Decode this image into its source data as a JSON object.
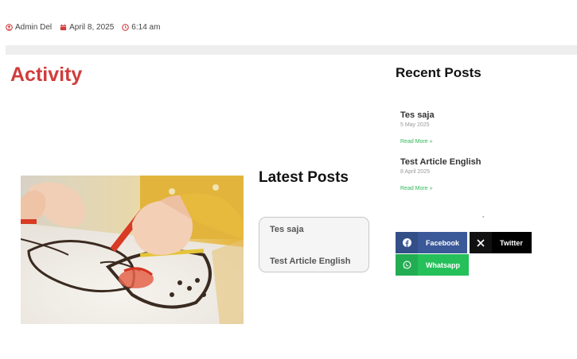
{
  "meta": {
    "author": "Admin Del",
    "date": "April 8, 2025",
    "time": "6:14 am"
  },
  "page": {
    "title": "Activity"
  },
  "latest_posts": {
    "title": "Latest Posts",
    "items": [
      "Tes saja",
      "Test Article English"
    ]
  },
  "recent_posts": {
    "title": "Recent Posts",
    "posts": [
      {
        "title": "Tes saja",
        "date": "5 May 2025",
        "read_more": "Read More »"
      },
      {
        "title": "Test Article English",
        "date": "8 April 2025",
        "read_more": "Read More »"
      }
    ]
  },
  "share": {
    "facebook": "Facebook",
    "twitter": "Twitter",
    "whatsapp": "Whatsapp"
  },
  "colors": {
    "accent": "#d13c3c",
    "read_more": "#2fb85a",
    "facebook": "#3b5998",
    "twitter": "#000000",
    "whatsapp": "#25c05a"
  }
}
